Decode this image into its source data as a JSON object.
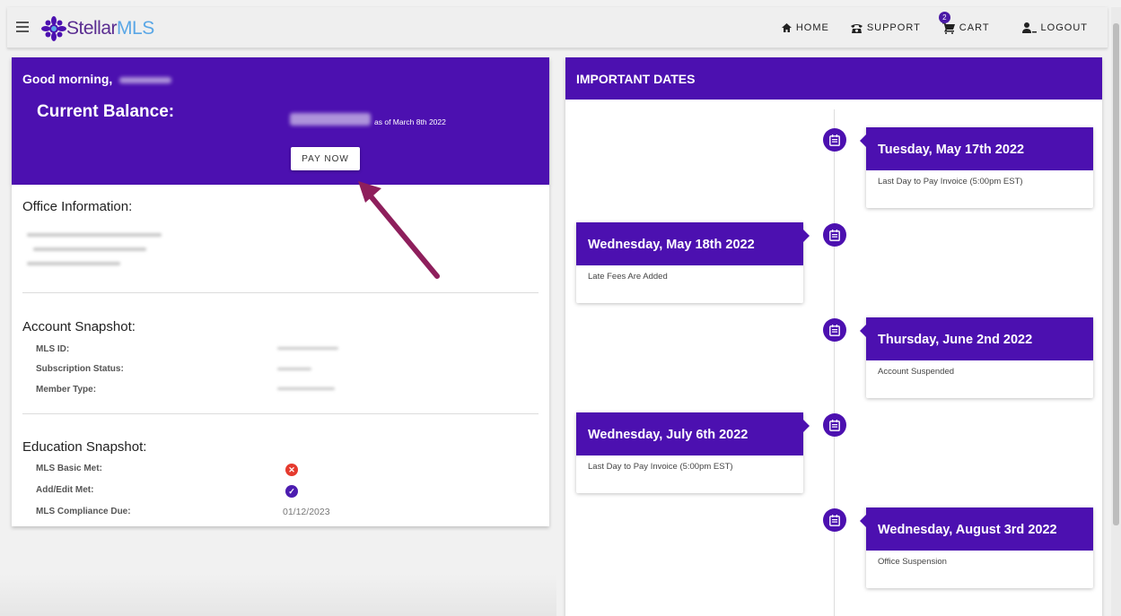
{
  "header": {
    "logo": {
      "part1": "Stellar",
      "part2": "MLS"
    },
    "nav": {
      "home": "HOME",
      "support": "SUPPORT",
      "cart": "CART",
      "cart_count": "2",
      "logout": "LOGOUT"
    }
  },
  "balance": {
    "greeting": "Good morning,",
    "label": "Current Balance:",
    "as_of": "as of March 8th 2022",
    "pay_button": "PAY NOW"
  },
  "office": {
    "title": "Office Information:"
  },
  "account": {
    "title": "Account Snapshot:",
    "fields": [
      {
        "label": "MLS ID:"
      },
      {
        "label": "Subscription Status:"
      },
      {
        "label": "Member Type:"
      }
    ]
  },
  "education": {
    "title": "Education Snapshot:",
    "fields": [
      {
        "label": "MLS Basic Met:",
        "icon": "x-circle-icon"
      },
      {
        "label": "Add/Edit Met:",
        "icon": "check-circle-icon"
      },
      {
        "label": "MLS Compliance Due:",
        "value": "01/12/2023"
      }
    ]
  },
  "important_dates": {
    "title": "IMPORTANT DATES",
    "items": [
      {
        "date": "Tuesday, May 17th 2022",
        "desc": "Last Day to Pay Invoice (5:00pm EST)"
      },
      {
        "date": "Wednesday, May 18th 2022",
        "desc": "Late Fees Are Added"
      },
      {
        "date": "Thursday, June 2nd 2022",
        "desc": "Account Suspended"
      },
      {
        "date": "Wednesday, July 6th 2022",
        "desc": "Last Day to Pay Invoice (5:00pm EST)"
      },
      {
        "date": "Wednesday, August 3rd 2022",
        "desc": "Office Suspension"
      }
    ]
  },
  "colors": {
    "primary": "#4c10b0",
    "error": "#e53a2e",
    "arrow": "#8e1f5c"
  }
}
